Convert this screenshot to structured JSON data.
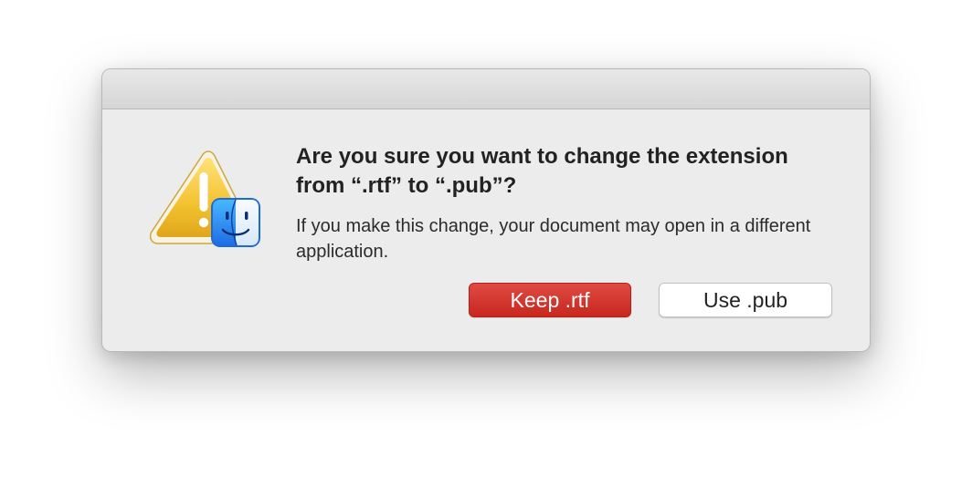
{
  "dialog": {
    "title": "Are you sure you want to change the extension from “.rtf” to “.pub”?",
    "message": "If you make this change, your document may open in a different application.",
    "buttons": {
      "keep_label": "Keep .rtf",
      "use_label": "Use .pub"
    },
    "icons": {
      "primary": "warning-icon",
      "badge": "finder-icon"
    },
    "colors": {
      "keep_button": "#d33a31",
      "warning": "#f2c12e",
      "finder_blue": "#2e8ef7"
    }
  }
}
